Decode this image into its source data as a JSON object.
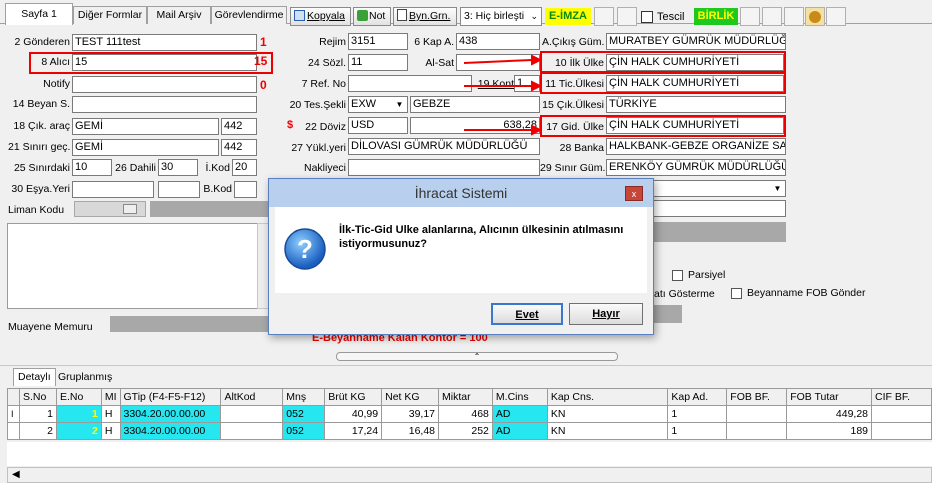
{
  "tabs": {
    "sayfa1": "Sayfa 1",
    "diger": "Diğer Formlar",
    "mail": "Mail Arşiv",
    "gorev": "Görevlendirme"
  },
  "toolbar": {
    "kopyala": "Kopyala",
    "not": "Not",
    "byn": "Byn.Grn.",
    "birlesti": "3: Hiç birleşti",
    "eimza": "E-İMZA",
    "tescil": "Tescil",
    "birlik": "BİRLİK"
  },
  "labels": {
    "gonderen": "2 Gönderen",
    "alici": "8 Alıcı",
    "notify": "Notify",
    "beyans": "14 Beyan S.",
    "cikarac": "18 Çık. araç",
    "sinirgec": "21 Sınırı geç.",
    "sinirdaki": "25 Sınırdaki",
    "dahili": "26 Dahili",
    "ikod": "İ.Kod",
    "esyayeri": "30 Eşya.Yeri",
    "bkod": "B.Kod",
    "limankodu": "Liman Kodu",
    "muayene": "Muayene Memuru",
    "rejim": "Rejim",
    "kapa": "6 Kap A.",
    "sozl": "24 Sözl.",
    "alsat": "Al-Sat",
    "refno": "7 Ref. No",
    "kont": "19.Kont",
    "tessekli": "20 Tes.Şekli",
    "doviz": "22 Döviz",
    "yukleri": "27 Yükl.yeri",
    "nakliyeci": "Nakliyeci",
    "acikis": "A.Çıkış Güm.",
    "ilkulke": "10 İlk Ülke",
    "ticulkesi": "11 Tic.Ülkesi",
    "cikulkesi": "15 Çık.Ülkesi",
    "gidulke": "17 Gid. Ülke",
    "banka": "28 Banka",
    "sinirgum": "29 Sınır Güm.",
    "parsiyel": "Parsiyel",
    "gosterme": "atı Gösterme",
    "fob": "Beyanname FOB Gönder",
    "dollar": "$"
  },
  "values": {
    "gonderen": "TEST 111test",
    "alici": "15",
    "rejim": "3151",
    "kapa": "438",
    "sozl": "11",
    "kont": "1",
    "tessekli": "EXW",
    "tesyer": "GEBZE",
    "doviz": "USD",
    "dovizval": "638,28",
    "yukleri": "DİLOVASI GÜMRÜK MÜDÜRLÜĞÜ",
    "cikarac": "GEMİ",
    "cikarac2": "442",
    "sinirgec": "GEMİ",
    "sinirgec2": "442",
    "sinirdaki": "10",
    "dahili": "30",
    "ikod": "20",
    "acikis": "MURATBEY GÜMRÜK MÜDÜRLÜĞ",
    "ilkulke": "ÇİN HALK CUMHURİYETİ",
    "ticulkesi": "ÇİN HALK CUMHURİYETİ",
    "cikulkesi": "TÜRKİYE",
    "gidulke": "ÇİN HALK CUMHURİYETİ",
    "banka": "HALKBANK-GEBZE ORGANİZE SA",
    "sinirgum": "ERENKÖY GÜMRÜK MÜDÜRLÜĞÜ"
  },
  "annotations": {
    "n1": "1",
    "n15": "15",
    "n0": "0",
    "kontor": "E-Beyanname Kalan Kontor = 100"
  },
  "dialog": {
    "title": "İhracat Sistemi",
    "message": "İlk-Tic-Gid Ulke alanlarına, Alıcının ülkesinin atılmasını istiyormusunuz?",
    "yes": "Evet",
    "no": "Hayır",
    "close": "x"
  },
  "bottom_tabs": {
    "detay": "Detaylı",
    "grup": "Gruplanmış"
  },
  "grid": {
    "headers": [
      "S.No",
      "E.No",
      "MI",
      "GTip (F4-F5-F12)",
      "AltKod",
      "Mnş",
      "Brüt KG",
      "Net KG",
      "Miktar",
      "M.Cins",
      "Kap Cns.",
      "Kap Ad.",
      "FOB BF.",
      "FOB Tutar",
      "CIF BF."
    ],
    "rows": [
      [
        "1",
        "1",
        "H",
        "3304.20.00.00.00",
        "",
        "052",
        "40,99",
        "39,17",
        "468",
        "AD",
        "KN",
        "1",
        "",
        "449,28",
        ""
      ],
      [
        "2",
        "2",
        "H",
        "3304.20.00.00.00",
        "",
        "052",
        "17,24",
        "16,48",
        "252",
        "AD",
        "KN",
        "1",
        "",
        "189",
        ""
      ]
    ]
  },
  "colors": {
    "red": "#e00000",
    "cyan": "#26e6f0",
    "eimza": "#ffff00",
    "birlik": "#1ec81e"
  }
}
